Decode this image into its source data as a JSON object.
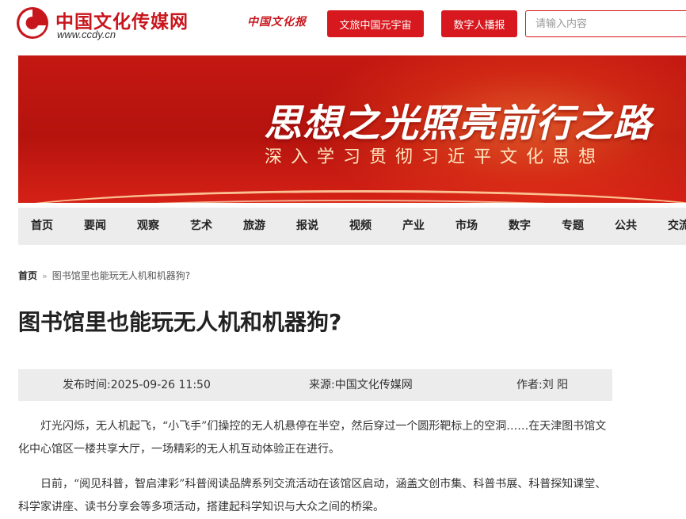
{
  "header": {
    "logo_title": "中国文化传媒网",
    "logo_url": "www.ccdy.cn",
    "paper_logo": "中国文化报",
    "btn_metaverse": "文旅中国元宇宙",
    "btn_digital_human": "数字人播报",
    "search_placeholder": "请输入内容"
  },
  "banner": {
    "title": "思想之光照亮前行之路",
    "subtitle": "深入学习贯彻习近平文化思想"
  },
  "nav": [
    "首页",
    "要闻",
    "观察",
    "艺术",
    "旅游",
    "报说",
    "视频",
    "产业",
    "市场",
    "数字",
    "专题",
    "公共",
    "交流"
  ],
  "breadcrumb": {
    "home": "首页",
    "separator": "»",
    "current": "图书馆里也能玩无人机和机器狗?"
  },
  "article": {
    "title": "图书馆里也能玩无人机和机器狗?",
    "publish_time": "发布时间:2025-09-26 11:50",
    "source": "来源:中国文化传媒网",
    "author": "作者:刘 阳",
    "paragraphs": [
      "灯光闪烁，无人机起飞，“小飞手”们操控的无人机悬停在半空，然后穿过一个圆形靶标上的空洞……在天津图书馆文化中心馆区一楼共享大厅，一场精彩的无人机互动体验正在进行。",
      "日前，“阅见科普，智启津彩”科普阅读品牌系列交流活动在该馆区启动，涵盖文创市集、科普书展、科普探知课堂、科学家讲座、读书分享会等多项活动，搭建起科学知识与大众之间的桥梁。"
    ]
  },
  "colors": {
    "brand_red": "#d7191f",
    "nav_bg": "#ececec",
    "meta_bg": "#ececec"
  }
}
